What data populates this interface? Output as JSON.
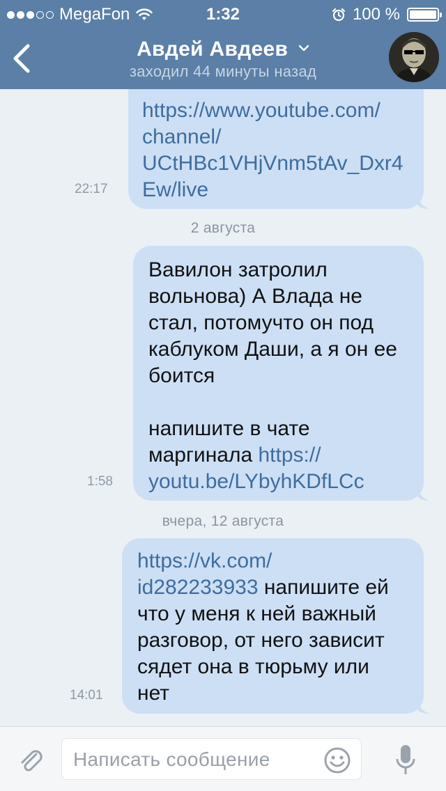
{
  "status_bar": {
    "carrier": "MegaFon",
    "time": "1:32",
    "battery": "100 %",
    "signal_icon": "signal-dots-icon",
    "wifi_icon": "wifi-icon",
    "alarm_icon": "alarm-icon",
    "battery_icon": "battery-icon"
  },
  "header": {
    "title": "Авдей Авдеев",
    "subtitle": "заходил 44 минуты назад",
    "back_icon": "chevron-left-icon",
    "dropdown_icon": "chevron-down-icon",
    "color": "#5b7fa6"
  },
  "messages": [
    {
      "time": "22:17",
      "lines": [
        [
          {
            "text": "https://www.youtube.com/",
            "link": true
          }
        ],
        [
          {
            "text": "channel/",
            "link": true
          }
        ],
        [
          {
            "text": "UCtHBc1VHjVnm5tAv_Dxr4",
            "link": true
          }
        ],
        [
          {
            "text": "Ew/live",
            "link": true
          }
        ]
      ]
    },
    {
      "date_separator": "2 августа",
      "time": "1:58",
      "lines": [
        [
          {
            "text": "Вавилон затролил"
          }
        ],
        [
          {
            "text": "вольнова) А Влада не"
          }
        ],
        [
          {
            "text": "стал, потомучто он под"
          }
        ],
        [
          {
            "text": "каблуком Даши, а я он ее"
          }
        ],
        [
          {
            "text": "боится"
          }
        ],
        [
          {
            "text": ""
          }
        ],
        [
          {
            "text": "напишите в чате"
          }
        ],
        [
          {
            "text": "маргинала "
          },
          {
            "text": "https://",
            "link": true
          }
        ],
        [
          {
            "text": "youtu.be/LYbyhKDfLCc",
            "link": true
          }
        ]
      ]
    },
    {
      "date_separator": "вчера, 12 августа",
      "time": "14:01",
      "lines": [
        [
          {
            "text": "https://vk.com/",
            "link": true
          }
        ],
        [
          {
            "text": "id282233933",
            "link": true
          },
          {
            "text": " напишите ей"
          }
        ],
        [
          {
            "text": "что у меня к ней важный"
          }
        ],
        [
          {
            "text": "разговор, от него зависит"
          }
        ],
        [
          {
            "text": "сядет она в тюрьму или"
          }
        ],
        [
          {
            "text": "нет"
          }
        ]
      ]
    }
  ],
  "input_bar": {
    "placeholder": "Написать сообщение",
    "attach_icon": "paperclip-icon",
    "emoji_icon": "smiley-icon",
    "mic_icon": "microphone-icon"
  },
  "colors": {
    "bubble": "#cddff5",
    "link": "#3e6d9e",
    "background": "#ebf0f5"
  }
}
